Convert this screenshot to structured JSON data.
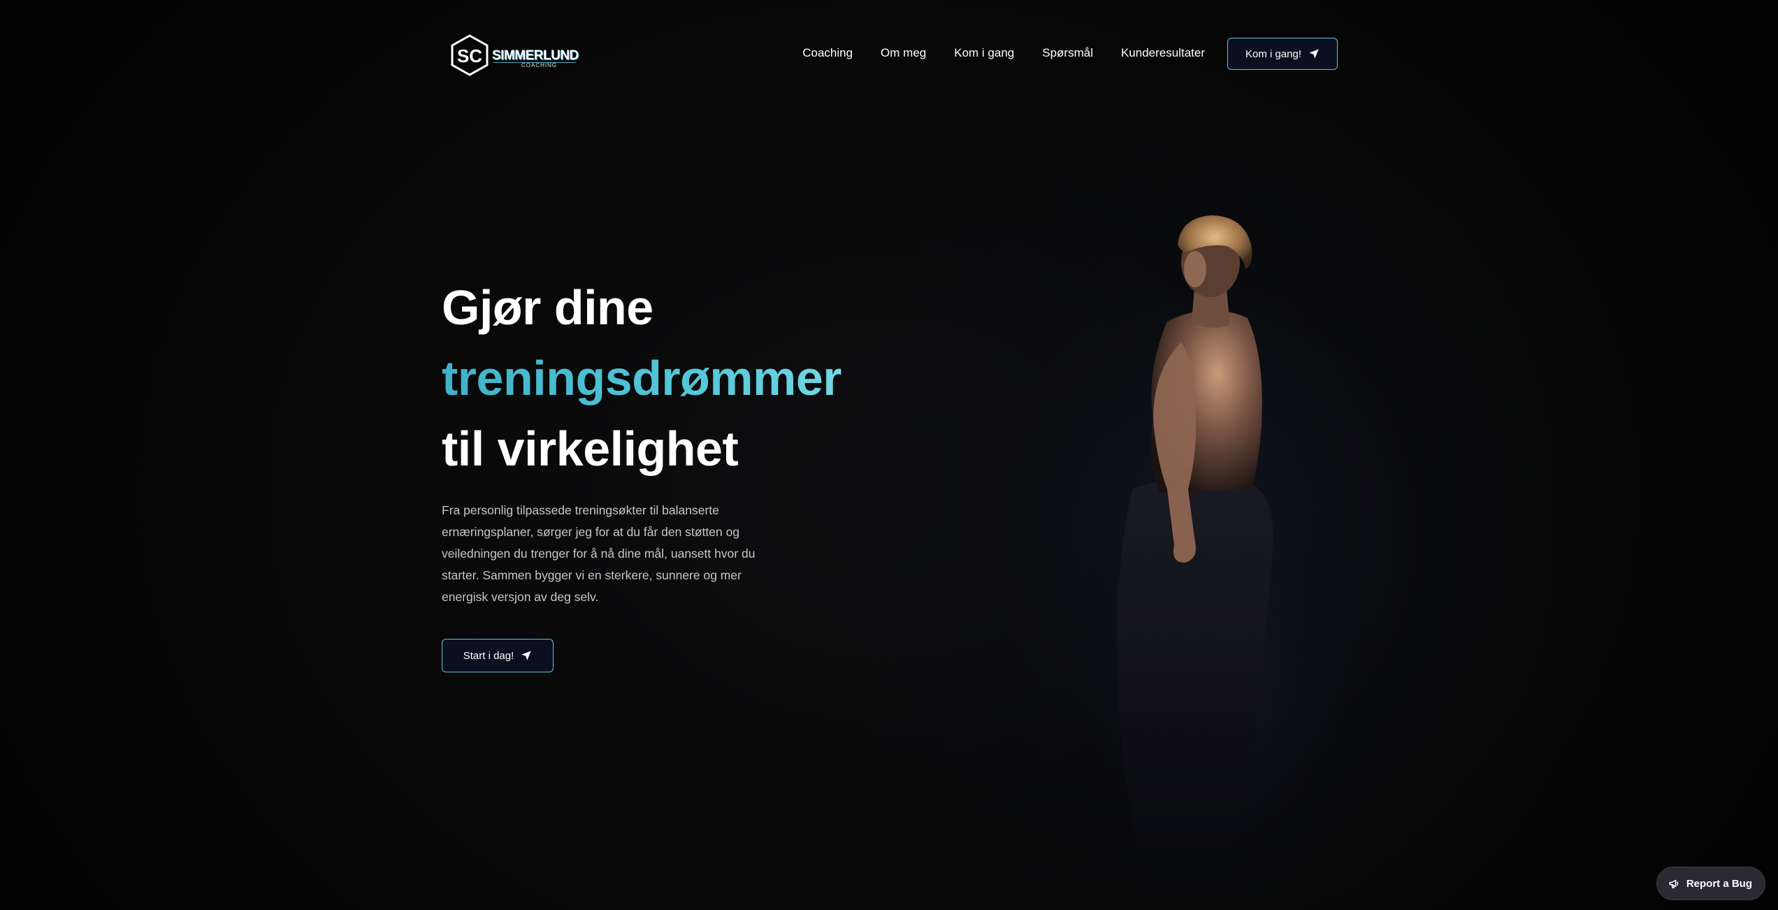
{
  "brand": {
    "name": "SIMMERLUND",
    "sub": "COACHING",
    "mark": "SC"
  },
  "nav": {
    "links": [
      "Coaching",
      "Om meg",
      "Kom i gang",
      "Spørsmål",
      "Kunderesultater"
    ],
    "cta_label": "Kom i gang!"
  },
  "hero": {
    "title_line1": "Gjør dine",
    "title_line2": "treningsdrømmer",
    "title_line3": "til virkelighet",
    "description": "Fra personlig tilpassede treningsøkter til balanserte ernæringsplaner, sørger jeg for at du får den støtten og veiledningen du trenger for å nå dine mål, uansett hvor du starter. Sammen bygger vi en sterkere, sunnere og mer energisk versjon av deg selv.",
    "cta_label": "Start i dag!"
  },
  "footer": {
    "bug_label": "Report a Bug"
  },
  "colors": {
    "accent": "#57c8d9",
    "background": "#050505",
    "button_bg": "#0b1020"
  },
  "icons": {
    "cta": "send-icon",
    "bug": "megaphone-icon"
  }
}
